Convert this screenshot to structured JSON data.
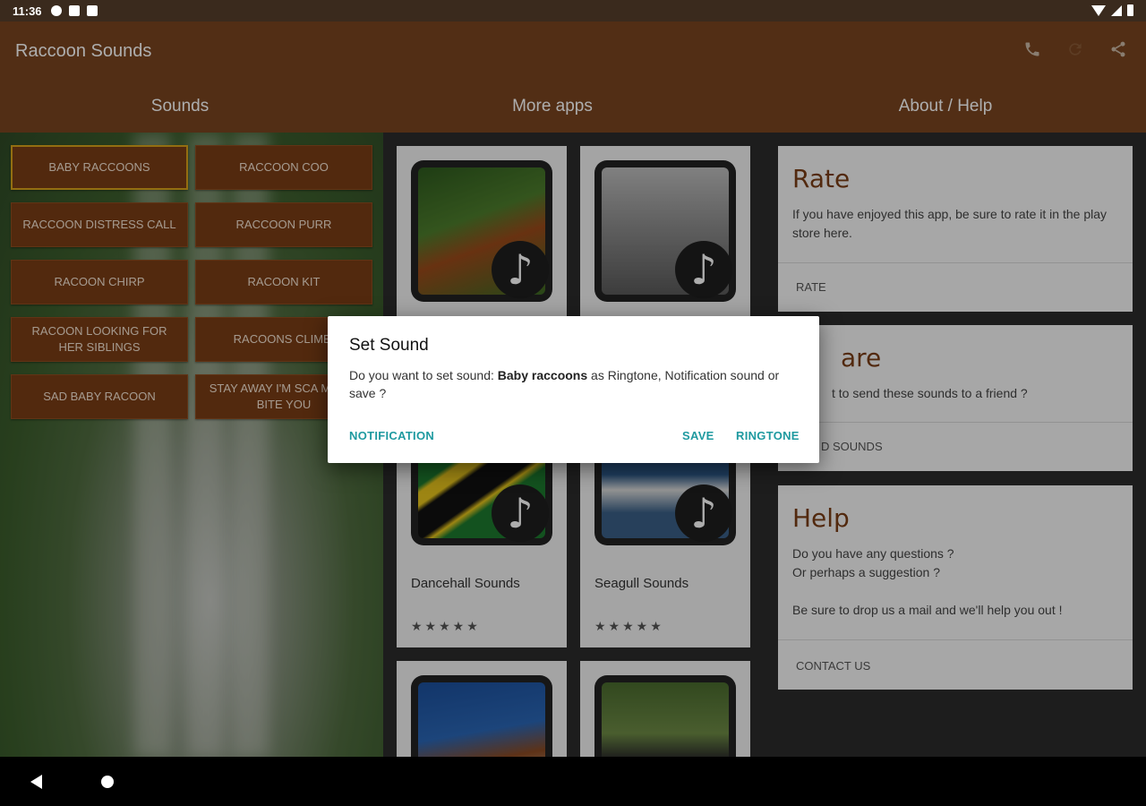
{
  "status_bar": {
    "time": "11:36"
  },
  "app": {
    "title": "Raccoon Sounds",
    "actions": [
      "phone-icon",
      "refresh-icon",
      "share-icon"
    ],
    "tabs": [
      "Sounds",
      "More apps",
      "About / Help"
    ]
  },
  "sounds": {
    "buttons": [
      "BABY RACCOONS",
      "RACCOON COO",
      "RACCOON DISTRESS CALL",
      "RACCOON PURR",
      "RACOON CHIRP",
      "RACOON KIT",
      "RACOON LOOKING FOR HER SIBLINGS",
      "RACOONS CLIMBI",
      "SAD BABY RACOON",
      "STAY AWAY I'M SCA MIGHT BITE YOU"
    ],
    "selected_index": 0
  },
  "more_apps": {
    "cards": [
      {
        "title": "",
        "stars": ""
      },
      {
        "title": "",
        "stars": ""
      },
      {
        "title": "Dancehall Sounds",
        "stars": "★★★★★"
      },
      {
        "title": "Seagull Sounds",
        "stars": "★★★★★"
      },
      {
        "title": "",
        "stars": ""
      },
      {
        "title": "",
        "stars": ""
      }
    ]
  },
  "about": {
    "rate": {
      "title": "Rate",
      "desc": "If you have enjoyed this app, be sure to rate it in the play store here.",
      "link": "RATE"
    },
    "share": {
      "title": "are",
      "desc": "t to send these sounds to a friend ?",
      "link": "D SOUNDS"
    },
    "help": {
      "title": "Help",
      "desc_line1": "Do you have any questions ?",
      "desc_line2": "Or perhaps a suggestion ?",
      "desc_line3": "Be sure to drop us a mail and we'll help you out !",
      "link": "CONTACT US"
    }
  },
  "dialog": {
    "title": "Set Sound",
    "msg_prefix": "Do you want to set sound: ",
    "msg_sound": "Baby raccoons",
    "msg_suffix": " as Ringtone, Notification sound or save ?",
    "btn_notification": "NOTIFICATION",
    "btn_save": "SAVE",
    "btn_ringtone": "RINGTONE"
  },
  "colors": {
    "app_bar": "#7a4520",
    "sound_button": "#7a3d16",
    "selected_border": "#d9a21a",
    "dialog_accent": "#1f9aa0"
  }
}
